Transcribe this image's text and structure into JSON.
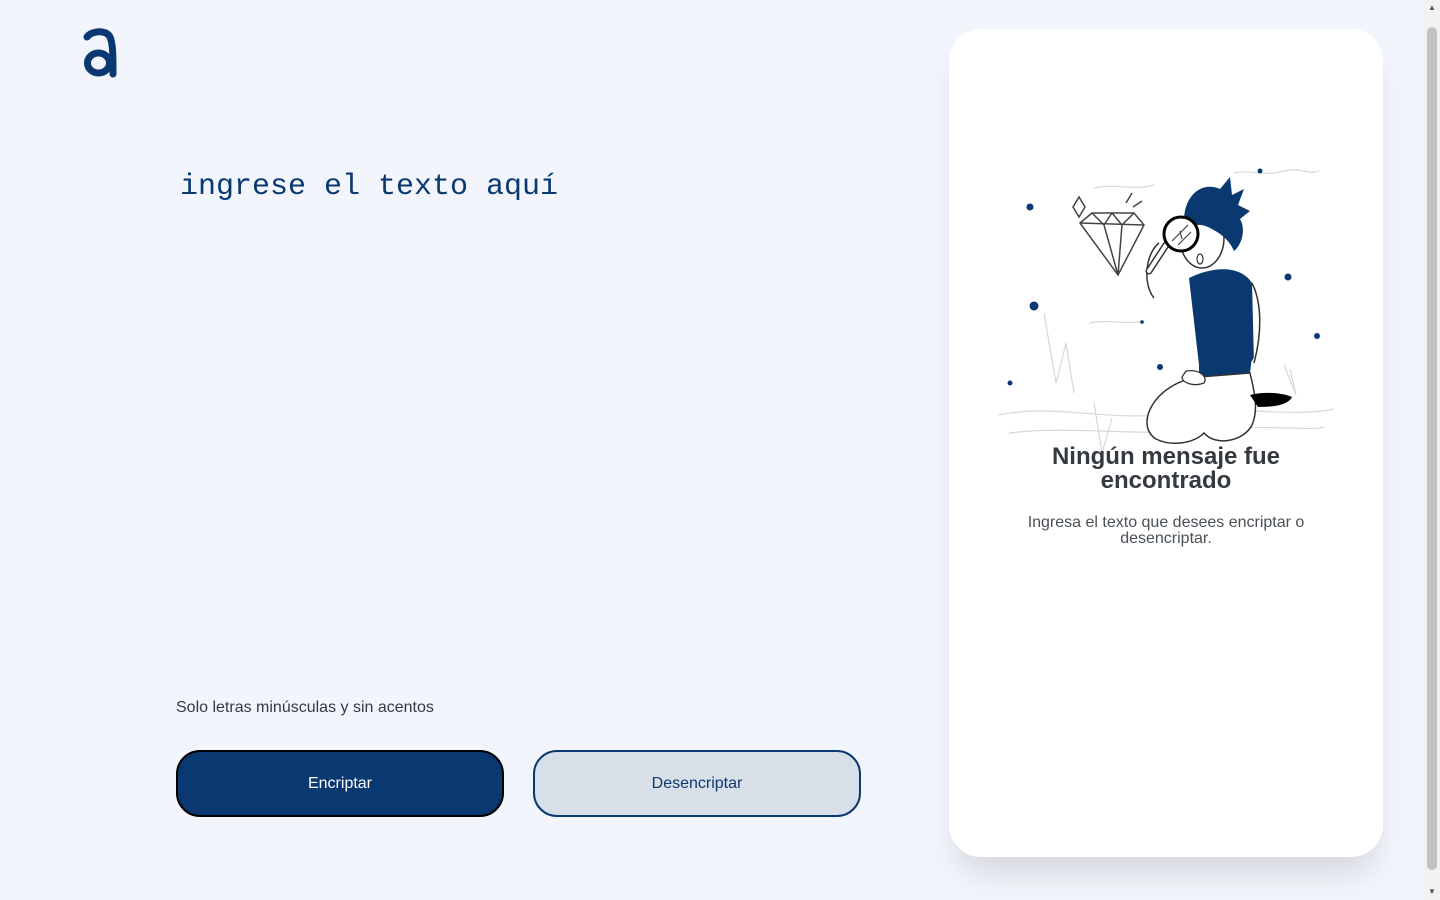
{
  "logo": {
    "letter": "a",
    "icon": "logo-a-icon"
  },
  "input": {
    "placeholder": "ingrese el texto aquí",
    "value": ""
  },
  "hint": {
    "text": "Solo letras minúsculas y sin acentos"
  },
  "buttons": {
    "encrypt_label": "Encriptar",
    "decrypt_label": "Desencriptar"
  },
  "panel": {
    "title": "Ningún mensaje fue encontrado",
    "subtitle": "Ingresa el texto que desees encriptar o desencriptar.",
    "illustration": "person-with-magnifier-illustration"
  },
  "colors": {
    "background": "#f3f5fc",
    "primary": "#0a3871",
    "secondary_button_bg": "#d8dfe8",
    "panel_bg": "#ffffff",
    "text": "#343a40"
  }
}
